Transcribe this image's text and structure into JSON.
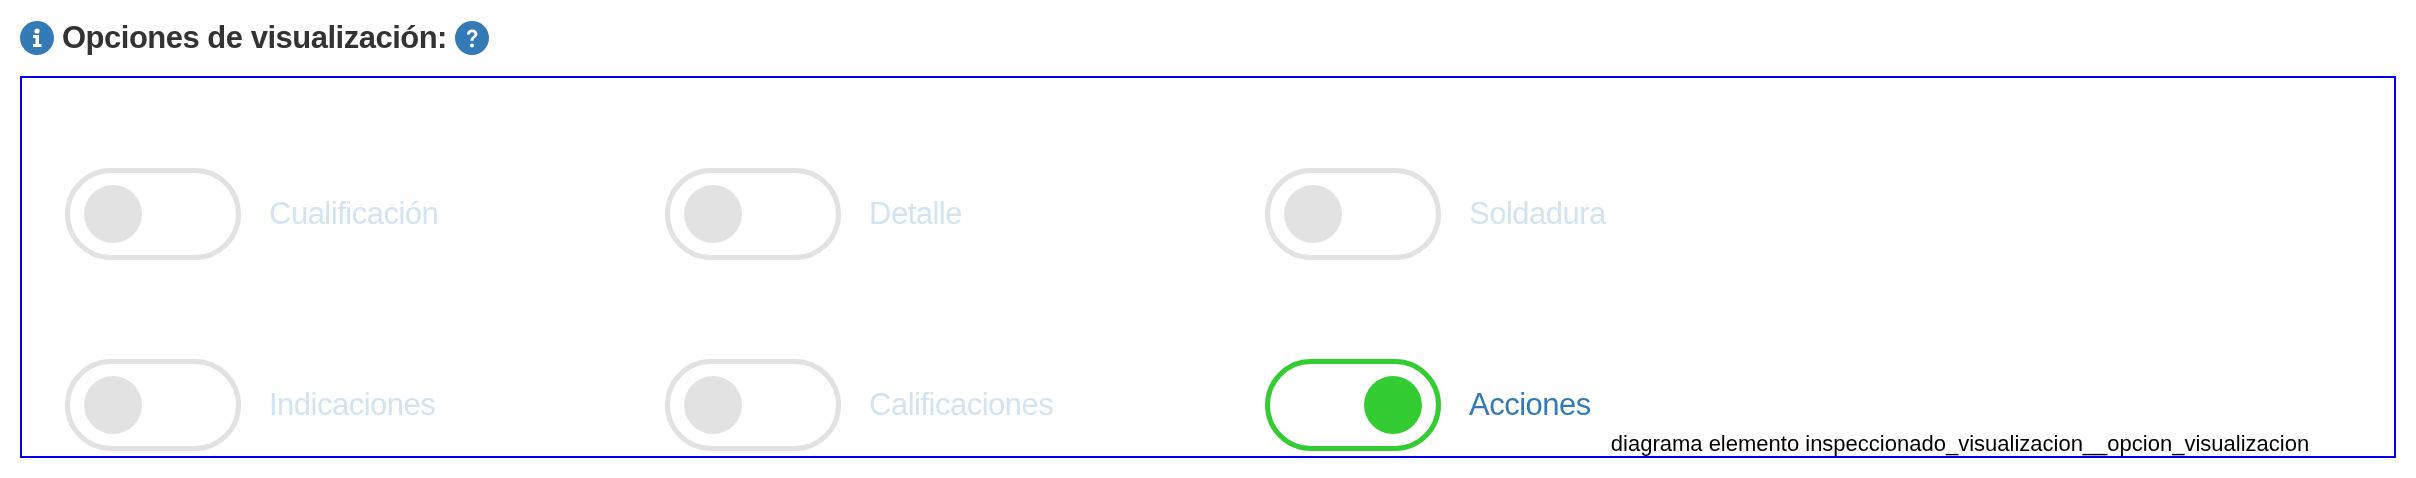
{
  "header": {
    "title": "Opciones de visualización:"
  },
  "options": [
    {
      "label": "Cualificación",
      "checked": false,
      "disabled": true
    },
    {
      "label": "Detalle",
      "checked": false,
      "disabled": true
    },
    {
      "label": "Soldadura",
      "checked": false,
      "disabled": true
    },
    {
      "label": "Indicaciones",
      "checked": false,
      "disabled": true
    },
    {
      "label": "Calificaciones",
      "checked": false,
      "disabled": true
    },
    {
      "label": "Acciones",
      "checked": true,
      "disabled": false
    }
  ],
  "caption": "diagrama elemento inspeccionado_visualizacion__opcion_visualizacion"
}
